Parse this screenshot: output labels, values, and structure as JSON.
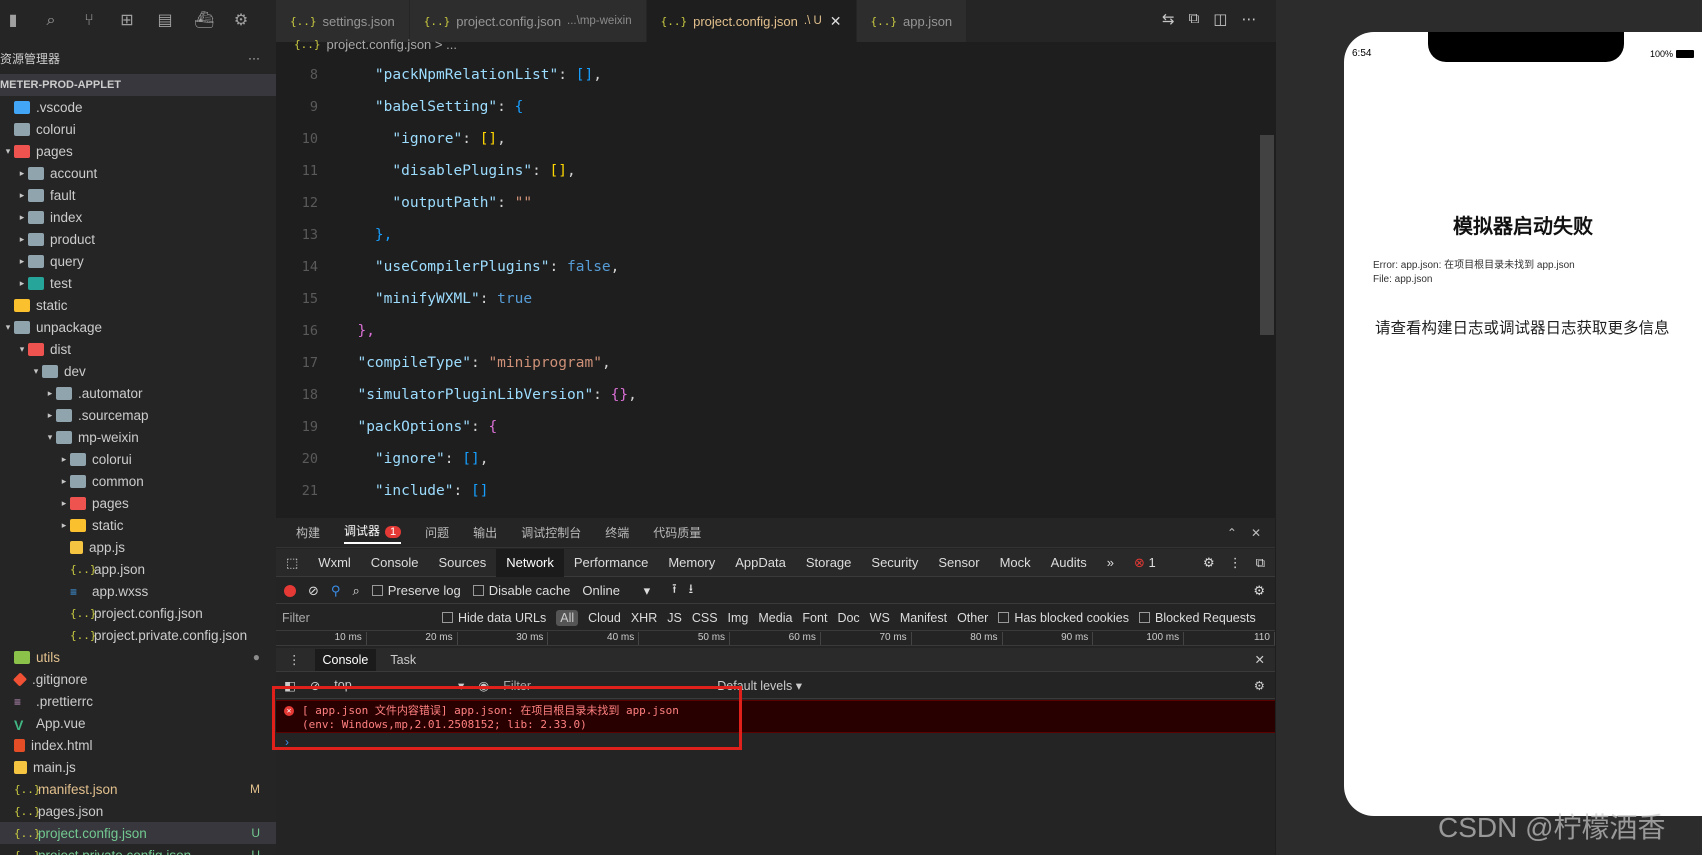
{
  "sidebar": {
    "title": "资源管理器",
    "more": "···",
    "project": "METER-PROD-APPLET",
    "items": [
      {
        "label": ".vscode",
        "indent": 0,
        "icon": "blue",
        "tw": ""
      },
      {
        "label": "colorui",
        "indent": 0,
        "icon": "folder",
        "tw": ""
      },
      {
        "label": "pages",
        "indent": 0,
        "icon": "red",
        "tw": "▾"
      },
      {
        "label": "account",
        "indent": 1,
        "icon": "folder",
        "tw": "▸"
      },
      {
        "label": "fault",
        "indent": 1,
        "icon": "folder",
        "tw": "▸"
      },
      {
        "label": "index",
        "indent": 1,
        "icon": "folder",
        "tw": "▸"
      },
      {
        "label": "product",
        "indent": 1,
        "icon": "folder",
        "tw": "▸"
      },
      {
        "label": "query",
        "indent": 1,
        "icon": "folder",
        "tw": "▸"
      },
      {
        "label": "test",
        "indent": 1,
        "icon": "teal",
        "tw": "▸"
      },
      {
        "label": "static",
        "indent": 0,
        "icon": "yellow",
        "tw": ""
      },
      {
        "label": "unpackage",
        "indent": 0,
        "icon": "folder",
        "tw": "▾"
      },
      {
        "label": "dist",
        "indent": 1,
        "icon": "red",
        "tw": "▾"
      },
      {
        "label": "dev",
        "indent": 2,
        "icon": "folder",
        "tw": "▾"
      },
      {
        "label": ".automator",
        "indent": 3,
        "icon": "folder",
        "tw": "▸"
      },
      {
        "label": ".sourcemap",
        "indent": 3,
        "icon": "folder",
        "tw": "▸"
      },
      {
        "label": "mp-weixin",
        "indent": 3,
        "icon": "folder",
        "tw": "▾"
      },
      {
        "label": "colorui",
        "indent": 4,
        "icon": "folder",
        "tw": "▸"
      },
      {
        "label": "common",
        "indent": 4,
        "icon": "folder",
        "tw": "▸"
      },
      {
        "label": "pages",
        "indent": 4,
        "icon": "red",
        "tw": "▸"
      },
      {
        "label": "static",
        "indent": 4,
        "icon": "yellow",
        "tw": "▸"
      },
      {
        "label": "app.js",
        "indent": 4,
        "icon": "js",
        "tw": ""
      },
      {
        "label": "app.json",
        "indent": 4,
        "icon": "json",
        "tw": ""
      },
      {
        "label": "app.wxss",
        "indent": 4,
        "icon": "css",
        "tw": ""
      },
      {
        "label": "project.config.json",
        "indent": 4,
        "icon": "json",
        "tw": ""
      },
      {
        "label": "project.private.config.json",
        "indent": 4,
        "icon": "json",
        "tw": ""
      },
      {
        "label": "utils",
        "indent": 0,
        "icon": "green",
        "tw": "",
        "git": "●",
        "gitColor": "#8c8c8c",
        "labelColor": "#e2c08d"
      },
      {
        "label": ".gitignore",
        "indent": 0,
        "icon": "git",
        "tw": ""
      },
      {
        "label": ".prettierrc",
        "indent": 0,
        "icon": "prettier",
        "tw": ""
      },
      {
        "label": "App.vue",
        "indent": 0,
        "icon": "vue",
        "tw": ""
      },
      {
        "label": "index.html",
        "indent": 0,
        "icon": "html",
        "tw": ""
      },
      {
        "label": "main.js",
        "indent": 0,
        "icon": "js",
        "tw": ""
      },
      {
        "label": "manifest.json",
        "indent": 0,
        "icon": "json",
        "tw": "",
        "git": "M",
        "gitColor": "#e2c08d",
        "labelColor": "#e2c08d"
      },
      {
        "label": "pages.json",
        "indent": 0,
        "icon": "json",
        "tw": ""
      },
      {
        "label": "project.config.json",
        "indent": 0,
        "icon": "json",
        "tw": "",
        "git": "U",
        "gitColor": "#73c991",
        "labelColor": "#73c991",
        "selected": true
      },
      {
        "label": "project.private.config.json",
        "indent": 0,
        "icon": "json",
        "tw": "",
        "git": "U",
        "gitColor": "#73c991",
        "labelColor": "#73c991"
      }
    ]
  },
  "tabs": [
    {
      "label": "settings.json",
      "desc": "",
      "active": false
    },
    {
      "label": "project.config.json",
      "desc": "...\\mp-weixin",
      "active": false
    },
    {
      "label": "project.config.json",
      "desc": ".\\ U",
      "active": true
    },
    {
      "label": "app.json",
      "desc": "",
      "active": false
    }
  ],
  "breadcrumb": "project.config.json > ...",
  "code": [
    {
      "n": "8",
      "s": [
        [
          "    ",
          ""
        ],
        [
          "\"packNpmRelationList\"",
          "key"
        ],
        [
          ": ",
          "p"
        ],
        [
          "[]",
          "b3"
        ],
        [
          ",",
          "p"
        ]
      ]
    },
    {
      "n": "9",
      "s": [
        [
          "    ",
          ""
        ],
        [
          "\"babelSetting\"",
          "key"
        ],
        [
          ": ",
          "p"
        ],
        [
          "{",
          "b3"
        ]
      ]
    },
    {
      "n": "10",
      "s": [
        [
          "      ",
          ""
        ],
        [
          "\"ignore\"",
          "key"
        ],
        [
          ": ",
          "p"
        ],
        [
          "[]",
          "b1"
        ],
        [
          ",",
          "p"
        ]
      ]
    },
    {
      "n": "11",
      "s": [
        [
          "      ",
          ""
        ],
        [
          "\"disablePlugins\"",
          "key"
        ],
        [
          ": ",
          "p"
        ],
        [
          "[]",
          "b1"
        ],
        [
          ",",
          "p"
        ]
      ]
    },
    {
      "n": "12",
      "s": [
        [
          "      ",
          ""
        ],
        [
          "\"outputPath\"",
          "key"
        ],
        [
          ": ",
          "p"
        ],
        [
          "\"\"",
          "q"
        ]
      ]
    },
    {
      "n": "13",
      "s": [
        [
          "    ",
          ""
        ],
        [
          "},",
          "b3"
        ]
      ]
    },
    {
      "n": "14",
      "s": [
        [
          "    ",
          ""
        ],
        [
          "\"useCompilerPlugins\"",
          "key"
        ],
        [
          ": ",
          "p"
        ],
        [
          "false",
          "kw"
        ],
        [
          ",",
          "p"
        ]
      ]
    },
    {
      "n": "15",
      "s": [
        [
          "    ",
          ""
        ],
        [
          "\"minifyWXML\"",
          "key"
        ],
        [
          ": ",
          "p"
        ],
        [
          "true",
          "kw"
        ]
      ]
    },
    {
      "n": "16",
      "s": [
        [
          "  ",
          ""
        ],
        [
          "},",
          "b2"
        ]
      ]
    },
    {
      "n": "17",
      "s": [
        [
          "  ",
          ""
        ],
        [
          "\"compileType\"",
          "key"
        ],
        [
          ": ",
          "p"
        ],
        [
          "\"miniprogram\"",
          "q"
        ],
        [
          ",",
          "p"
        ]
      ]
    },
    {
      "n": "18",
      "s": [
        [
          "  ",
          ""
        ],
        [
          "\"simulatorPluginLibVersion\"",
          "key"
        ],
        [
          ": ",
          "p"
        ],
        [
          "{}",
          "b2"
        ],
        [
          ",",
          "p"
        ]
      ]
    },
    {
      "n": "19",
      "s": [
        [
          "  ",
          ""
        ],
        [
          "\"packOptions\"",
          "key"
        ],
        [
          ": ",
          "p"
        ],
        [
          "{",
          "b2"
        ]
      ]
    },
    {
      "n": "20",
      "s": [
        [
          "    ",
          ""
        ],
        [
          "\"ignore\"",
          "key"
        ],
        [
          ": ",
          "p"
        ],
        [
          "[]",
          "b3"
        ],
        [
          ",",
          "p"
        ]
      ]
    },
    {
      "n": "21",
      "s": [
        [
          "    ",
          ""
        ],
        [
          "\"include\"",
          "key"
        ],
        [
          ": ",
          "p"
        ],
        [
          "[]",
          "b3"
        ]
      ]
    }
  ],
  "colors": {
    "key": "#ce9178",
    "string": "#ce9178",
    "keyword": "#569cd6"
  },
  "panel_tabs": [
    "构建",
    "调试器",
    "问题",
    "输出",
    "调试控制台",
    "终端",
    "代码质量"
  ],
  "panel_badge": "1",
  "devtools_tabs": [
    "Wxml",
    "Console",
    "Sources",
    "Network",
    "Performance",
    "Memory",
    "AppData",
    "Storage",
    "Security",
    "Sensor",
    "Mock",
    "Audits"
  ],
  "devtools_more": "»",
  "devtools_errcount": "1",
  "network": {
    "preserve": "Preserve log",
    "disable": "Disable cache",
    "online": "Online"
  },
  "filter": {
    "placeholder": "Filter",
    "hide": "Hide data URLs",
    "all": "All",
    "types": [
      "Cloud",
      "XHR",
      "JS",
      "CSS",
      "Img",
      "Media",
      "Font",
      "Doc",
      "WS",
      "Manifest",
      "Other"
    ],
    "blocked_cookies": "Has blocked cookies",
    "blocked_requests": "Blocked Requests"
  },
  "ruler": [
    "10 ms",
    "20 ms",
    "30 ms",
    "40 ms",
    "50 ms",
    "60 ms",
    "70 ms",
    "80 ms",
    "90 ms",
    "100 ms",
    "110"
  ],
  "console_tabs": [
    "Console",
    "Task"
  ],
  "console_bar": {
    "context": "top",
    "filter": "Filter",
    "levels": "Default levels ▾"
  },
  "error": {
    "line1": "[ app.json 文件内容错误] app.json: 在项目根目录未找到 app.json",
    "line2": "(env: Windows,mp,2.01.2508152; lib: 2.33.0)"
  },
  "prompt": "›",
  "simulator": {
    "time": "6:54",
    "battery": "100%",
    "title": "模拟器启动失败",
    "err1": "Error: app.json: 在项目根目录未找到 app.json",
    "err2": "File: app.json",
    "more": "请查看构建日志或调试器日志获取更多信息"
  },
  "watermark": "CSDN @柠檬酒香"
}
